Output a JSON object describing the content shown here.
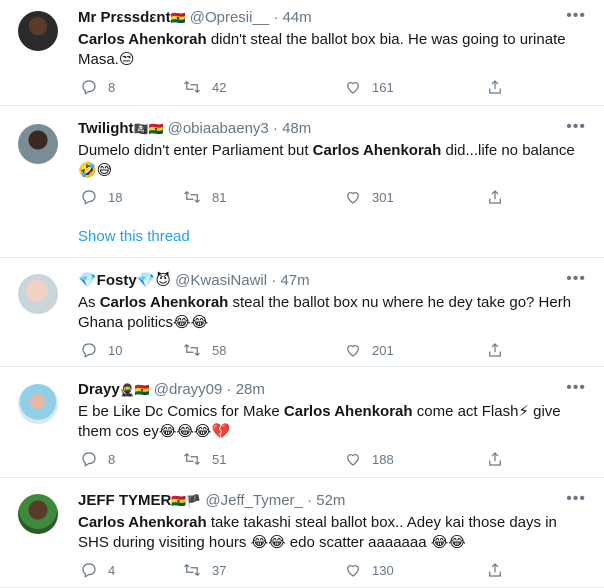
{
  "tweets": [
    {
      "name": "Mr Prεssdεnt",
      "name_emoji": "🇬🇭",
      "handle": "@Opresii__",
      "sep": "·",
      "time": "44m",
      "text_bold": "Carlos Ahenkorah",
      "text_rest": " didn't steal the ballot box bia. He was going to urinate Masa.😒",
      "replies": "8",
      "retweets": "42",
      "likes": "161"
    },
    {
      "name": "Twilight",
      "name_emoji": "🏴‍☠️🇬🇭",
      "handle": "@obiaabaeny3",
      "sep": "·",
      "time": "48m",
      "text_pre": "Dumelo didn't enter Parliament but ",
      "text_bold": "Carlos Ahenkorah",
      "text_rest": " did...life no balance 🤣😅",
      "replies": "18",
      "retweets": "81",
      "likes": "301",
      "thread_link": "Show this thread"
    },
    {
      "name": "💎Fosty💎😈",
      "name_emoji": "",
      "handle": "@KwasiNawil",
      "sep": "·",
      "time": "47m",
      "text_pre": "As ",
      "text_bold": "Carlos Ahenkorah",
      "text_rest": " steal the ballot box nu where he dey take go? Herh Ghana politics😂😂",
      "replies": "10",
      "retweets": "58",
      "likes": "201"
    },
    {
      "name": "Drayy",
      "name_emoji": "🥷🇬🇭",
      "handle": "@drayy09",
      "sep": "·",
      "time": "28m",
      "text_pre": "E be Like Dc Comics for Make ",
      "text_bold": "Carlos Ahenkorah",
      "text_rest": " come act Flash⚡ give them cos ey😂😂😂💔",
      "replies": "8",
      "retweets": "51",
      "likes": "188"
    },
    {
      "name": "JEFF TYMER",
      "name_emoji": "🇬🇭🏴",
      "handle": "@Jeff_Tymer_",
      "sep": "·",
      "time": "52m",
      "text_bold": "Carlos Ahenkorah",
      "text_rest": " take takashi steal ballot box.. Adey kai those days in SHS during visiting hours 😂😂 edo scatter aaaaaaa 😂😂",
      "replies": "4",
      "retweets": "37",
      "likes": "130"
    }
  ],
  "colors": {
    "link": "#1da1f2",
    "muted": "#657786",
    "divider": "#e6ecf0"
  },
  "icons": [
    "more-icon",
    "reply-icon",
    "retweet-icon",
    "like-icon",
    "share-icon"
  ]
}
